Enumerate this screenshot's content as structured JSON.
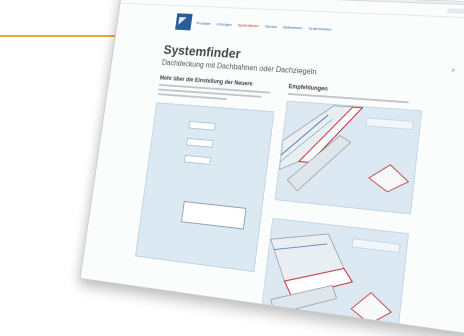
{
  "browser": {
    "tab_title": "",
    "toolbar_items": [
      "",
      ""
    ]
  },
  "site": {
    "nav": [
      {
        "label": "Produkte"
      },
      {
        "label": "Lösungen"
      },
      {
        "label": "Systemfinder"
      },
      {
        "label": "Service"
      },
      {
        "label": "Referenzen"
      },
      {
        "label": "Unternehmen"
      }
    ],
    "active_nav_index": 2,
    "brand_color": "#2a5b9a",
    "active_color": "#c2272d"
  },
  "page": {
    "title": "Systemfinder",
    "subtitle": "Dachdeckung mit Dachbahnen oder Dachziegeln"
  },
  "left": {
    "heading": "Mehr über die Einstellung der Neuere",
    "form_caption": "",
    "rows": [
      {
        "label": ""
      },
      {
        "label": ""
      },
      {
        "label": ""
      }
    ],
    "submit_label": ""
  },
  "right": {
    "heading": "Empfehlungen",
    "tiles": [
      {
        "label": "",
        "more": ""
      },
      {
        "label": "",
        "more": ""
      }
    ]
  },
  "icons": {
    "search": "search-icon"
  }
}
